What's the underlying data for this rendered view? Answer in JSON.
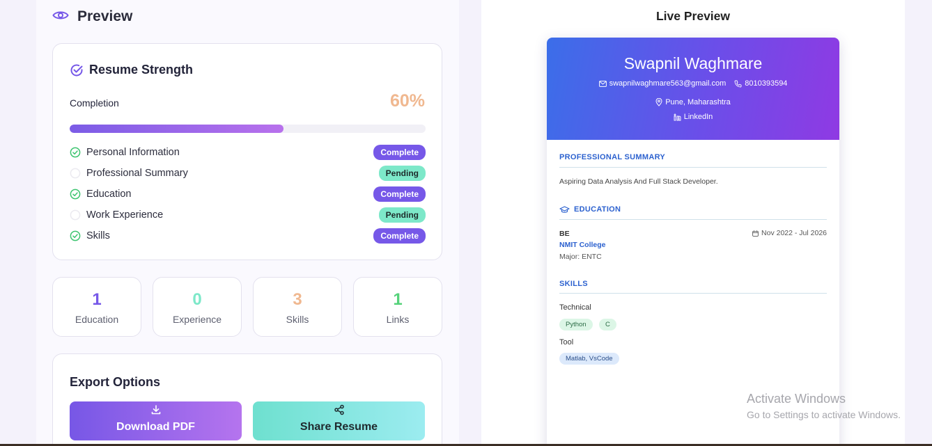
{
  "preview": {
    "title": "Preview"
  },
  "strength": {
    "title": "Resume Strength",
    "completion_label": "Completion",
    "completion_value": "60%",
    "progress": 0.6,
    "items": [
      {
        "label": "Personal Information",
        "status": "Complete",
        "done": true
      },
      {
        "label": "Professional Summary",
        "status": "Pending",
        "done": false
      },
      {
        "label": "Education",
        "status": "Complete",
        "done": true
      },
      {
        "label": "Work Experience",
        "status": "Pending",
        "done": false
      },
      {
        "label": "Skills",
        "status": "Complete",
        "done": true
      }
    ]
  },
  "stats": [
    {
      "value": "1",
      "label": "Education",
      "color": "#7658e8"
    },
    {
      "value": "0",
      "label": "Experience",
      "color": "#7de8c9"
    },
    {
      "value": "3",
      "label": "Skills",
      "color": "#f0b890"
    },
    {
      "value": "1",
      "label": "Links",
      "color": "#55d27a"
    }
  ],
  "export": {
    "title": "Export Options",
    "download_label": "Download PDF",
    "share_label": "Share Resume"
  },
  "live": {
    "title": "Live Preview",
    "name": "Swapnil Waghmare",
    "email": "swapnilwaghmare563@gmail.com",
    "phone": "8010393594",
    "location": "Pune, Maharashtra",
    "linkedin": "LinkedIn",
    "summary_title": "PROFESSIONAL SUMMARY",
    "summary_text": "Aspiring Data Analysis And Full Stack Developer.",
    "education_title": "EDUCATION",
    "degree": "BE",
    "dates": "Nov 2022 - Jul 2026",
    "college": "NMIT College",
    "major": "Major: ENTC",
    "skills_title": "SKILLS",
    "technical_label": "Technical",
    "technical_skills": [
      "Python",
      "C"
    ],
    "tool_label": "Tool",
    "tool_skills": [
      "Matlab, VsCode"
    ]
  },
  "watermark": {
    "line1": "Activate Windows",
    "line2": "Go to Settings to activate Windows."
  },
  "colors": {
    "accent": "#7658e8",
    "pending": "#7de8c9",
    "check_green": "#3cc46f",
    "resume_blue": "#2d62cf"
  }
}
